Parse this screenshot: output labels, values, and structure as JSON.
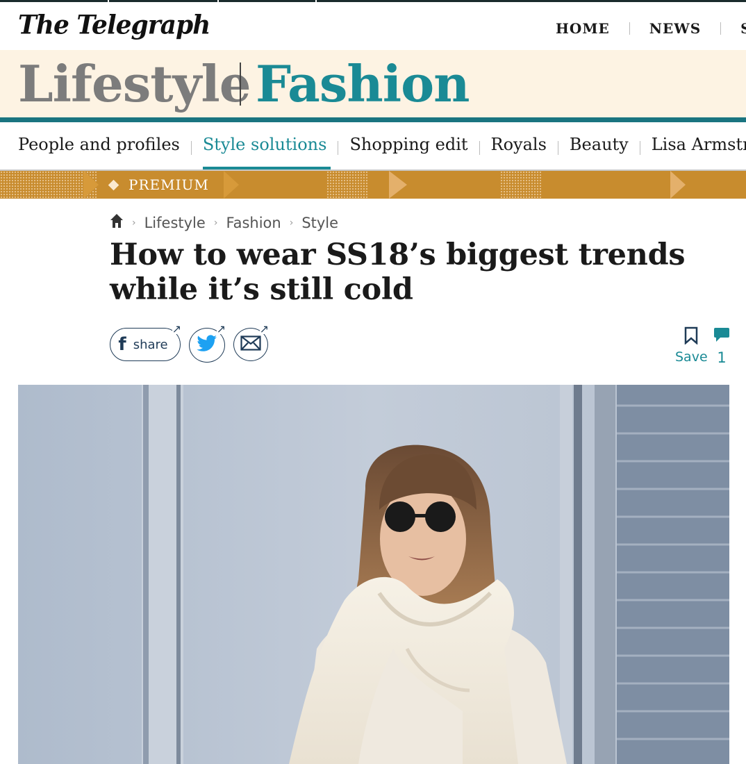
{
  "masthead": {
    "logo": "The Telegraph",
    "nav": [
      "HOME",
      "NEWS",
      "SP"
    ]
  },
  "section": {
    "parent": "Lifestyle",
    "current": "Fashion"
  },
  "subnav": {
    "items": [
      "People and profiles",
      "Style solutions",
      "Shopping edit",
      "Royals",
      "Beauty",
      "Lisa Armstrong"
    ],
    "active": "Style solutions"
  },
  "premium": {
    "label": "PREMIUM"
  },
  "breadcrumb": {
    "items": [
      "Lifestyle",
      "Fashion",
      "Style"
    ]
  },
  "article": {
    "headline": "How to wear SS18’s biggest trends while it’s still cold"
  },
  "share": {
    "facebook_label": "share"
  },
  "actions": {
    "save_label": "Save",
    "comment_count": "1"
  },
  "colors": {
    "teal": "#1a8a95",
    "premium_gold": "#c88c2e",
    "banner_bg": "#fdf3e3"
  },
  "icons": [
    "home-icon",
    "facebook-icon",
    "twitter-icon",
    "email-icon",
    "bookmark-icon",
    "comment-icon",
    "external-arrow-icon"
  ]
}
